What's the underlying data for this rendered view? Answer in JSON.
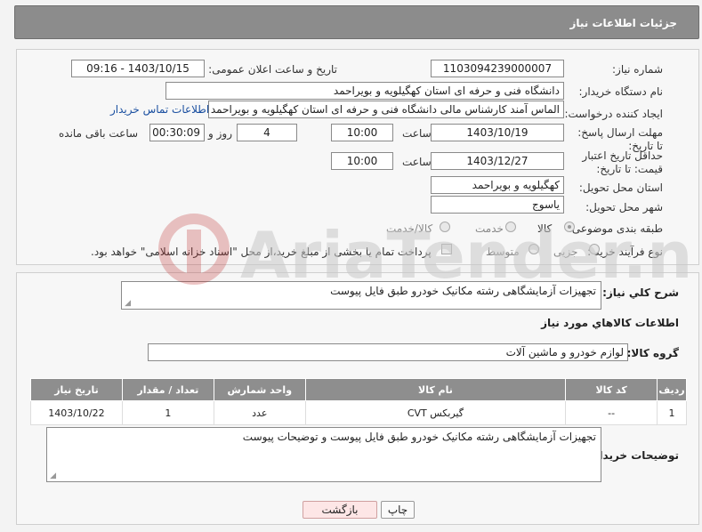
{
  "header": {
    "title": "جزئیات اطلاعات نیاز"
  },
  "form": {
    "need_number_label": "شماره نیاز:",
    "need_number": "1103094239000007",
    "announce_label": "تاریخ و ساعت اعلان عمومی:",
    "announce_value": "1403/10/15 - 09:16",
    "buyer_org_label": "نام دستگاه خریدار:",
    "buyer_org": "دانشگاه فنی و حرفه ای استان کهگیلویه و بویراحمد",
    "creator_label": "ایجاد کننده درخواست:",
    "creator": "الماس آمند کارشناس مالی دانشگاه فنی و حرفه ای استان کهگیلویه و بویراحمد",
    "contact_link": "اطلاعات تماس خریدار",
    "reply_deadline_label": "مهلت ارسال پاسخ: تا تاریخ:",
    "reply_date": "1403/10/19",
    "time_label": "ساعت",
    "reply_time": "10:00",
    "days_value": "4",
    "days_label": "روز و",
    "remaining_value": "00:30:09",
    "remaining_label": "ساعت باقی مانده",
    "validity_label": "حداقل تاریخ اعتبار قیمت: تا تاریخ:",
    "validity_date": "1403/12/27",
    "validity_time": "10:00",
    "province_label": "استان محل تحویل:",
    "province": "کهگیلویه و بویراحمد",
    "city_label": "شهر محل تحویل:",
    "city": "یاسوج",
    "category_label": "طبقه بندی موضوعی:",
    "category_options": [
      "کالا",
      "خدمت",
      "کالا/خدمت"
    ],
    "process_label": "نوع فرآیند خرید :",
    "process_options": [
      "جزیی",
      "متوسط"
    ],
    "payment_note": "پرداخت تمام یا بخشی از مبلغ خرید،از محل \"اسناد خزانه اسلامی\" خواهد بود."
  },
  "details": {
    "summary_label": "شرح کلي نياز:",
    "summary": "تجهیزات آزمایشگاهی رشته مکانیک خودرو طبق فایل پیوست",
    "goods_info_title": "اطلاعات کالاهاي مورد نياز",
    "goods_group_label": "گروه کالا:",
    "goods_group": "لوازم خودرو و ماشین آلات"
  },
  "table": {
    "headers": [
      "ردیف",
      "کد کالا",
      "نام کالا",
      "واحد شمارش",
      "تعداد / مقدار",
      "تاریخ نیاز"
    ],
    "rows": [
      [
        "1",
        "--",
        "گیربکس CVT",
        "عدد",
        "1",
        "1403/10/22"
      ]
    ]
  },
  "buyer_notes": {
    "label": "توضیحات خریدار:",
    "text": "تجهیزات آزمایشگاهی رشته مکانیک خودرو طبق فایل پیوست و توضیحات پیوست"
  },
  "buttons": {
    "print": "چاپ",
    "back": "بازگشت"
  },
  "watermark": {
    "text": "AriaTender.net"
  }
}
